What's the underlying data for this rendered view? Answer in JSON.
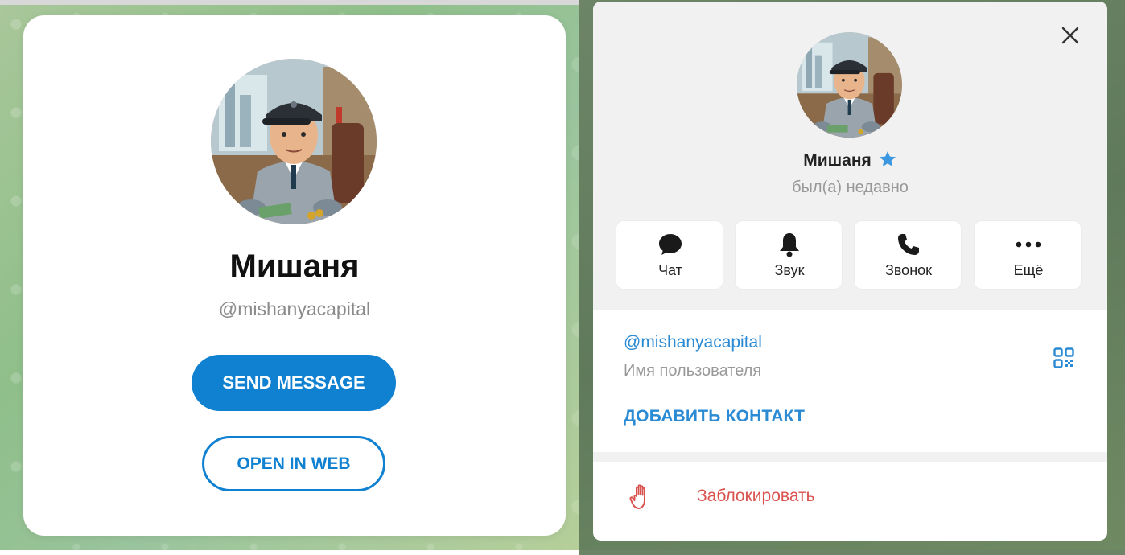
{
  "left": {
    "name": "Мишаня",
    "username": "@mishanyacapital",
    "send_message": "SEND MESSAGE",
    "open_in_web": "OPEN IN WEB"
  },
  "right": {
    "name": "Мишаня",
    "status": "был(а) недавно",
    "actions": [
      {
        "label": "Чат",
        "icon": "chat-bubble-icon"
      },
      {
        "label": "Звук",
        "icon": "bell-icon"
      },
      {
        "label": "Звонок",
        "icon": "phone-icon"
      },
      {
        "label": "Ещё",
        "icon": "more-dots-icon"
      }
    ],
    "username_link": "@mishanyacapital",
    "username_caption": "Имя пользователя",
    "add_contact": "ДОБАВИТЬ КОНТАКТ",
    "block": "Заблокировать"
  },
  "colors": {
    "accent": "#1081d1",
    "link": "#2a8ad3",
    "danger": "#d9534f",
    "star": "#3a97e0"
  }
}
